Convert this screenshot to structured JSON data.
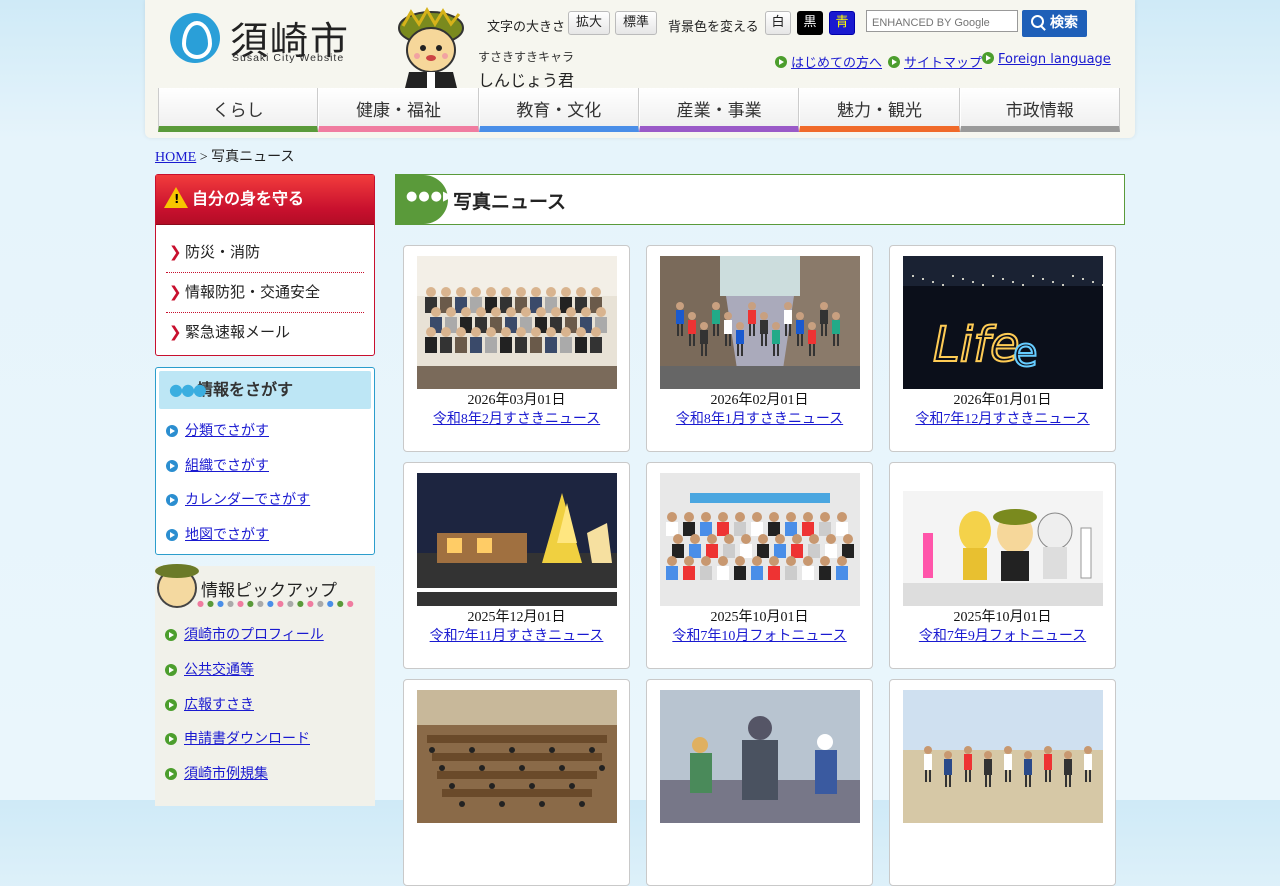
{
  "header": {
    "logo_title": "須崎市",
    "logo_sub": "Susaki City Website",
    "mascot_caption_1": "すさきすきキャラ",
    "mascot_caption_2": "しんじょう君",
    "textsize_label": "文字の大きさ",
    "btn_enlarge": "拡大",
    "btn_standard": "標準",
    "bgcolor_label": "背景色を変える",
    "btn_white": "白",
    "btn_black": "黒",
    "btn_blue": "青",
    "search_placeholder": "ENHANCED BY Google",
    "search_button": "検索",
    "link_first": "はじめての方へ",
    "link_sitemap": "サイトマップ",
    "link_foreign": "Foreign language"
  },
  "nav": [
    {
      "label": "くらし",
      "color": "#5a9a3a"
    },
    {
      "label": "健康・福祉",
      "color": "#f07ca0"
    },
    {
      "label": "教育・文化",
      "color": "#4a8ee8"
    },
    {
      "label": "産業・事業",
      "color": "#9a5ac8"
    },
    {
      "label": "魅力・観光",
      "color": "#f06a2a"
    },
    {
      "label": "市政情報",
      "color": "#9a9a9a"
    }
  ],
  "breadcrumb": {
    "home": "HOME",
    "sep": " > ",
    "current": "写真ニュース"
  },
  "sidebar": {
    "protect_title": "自分の身を守る",
    "protect_items": [
      "防災・消防",
      "情報防犯・交通安全",
      "緊急速報メール"
    ],
    "search_title": "情報をさがす",
    "search_items": [
      "分類でさがす",
      "組織でさがす",
      "カレンダーでさがす",
      "地図でさがす"
    ],
    "pickup_title": "情報ピックアップ",
    "pickup_items": [
      "須崎市のプロフィール",
      "公共交通等",
      "広報すさき",
      "申請書ダウンロード",
      "須崎市例規集"
    ]
  },
  "main": {
    "heading": "写真ニュース",
    "cards": [
      {
        "date": "2026年03月01日",
        "caption": "令和8年2月すさきニュース",
        "photo": "group-photo"
      },
      {
        "date": "2026年02月01日",
        "caption": "令和8年1月すさきニュース",
        "photo": "marathon"
      },
      {
        "date": "2026年01月01日",
        "caption": "令和7年12月すさきニュース",
        "photo": "night-lights"
      },
      {
        "date": "2025年12月01日",
        "caption": "令和7年11月すさきニュース",
        "photo": "illumination-street"
      },
      {
        "date": "2025年10月01日",
        "caption": "令和7年10月フォトニュース",
        "photo": "group-indoor"
      },
      {
        "date": "2025年10月01日",
        "caption": "令和7年9月フォトニュース",
        "photo": "mascots-stage"
      },
      {
        "date": "",
        "caption": "",
        "photo": "council-chamber"
      },
      {
        "date": "",
        "caption": "",
        "photo": "statue-cleaning"
      },
      {
        "date": "",
        "caption": "",
        "photo": "field-activity"
      }
    ]
  }
}
